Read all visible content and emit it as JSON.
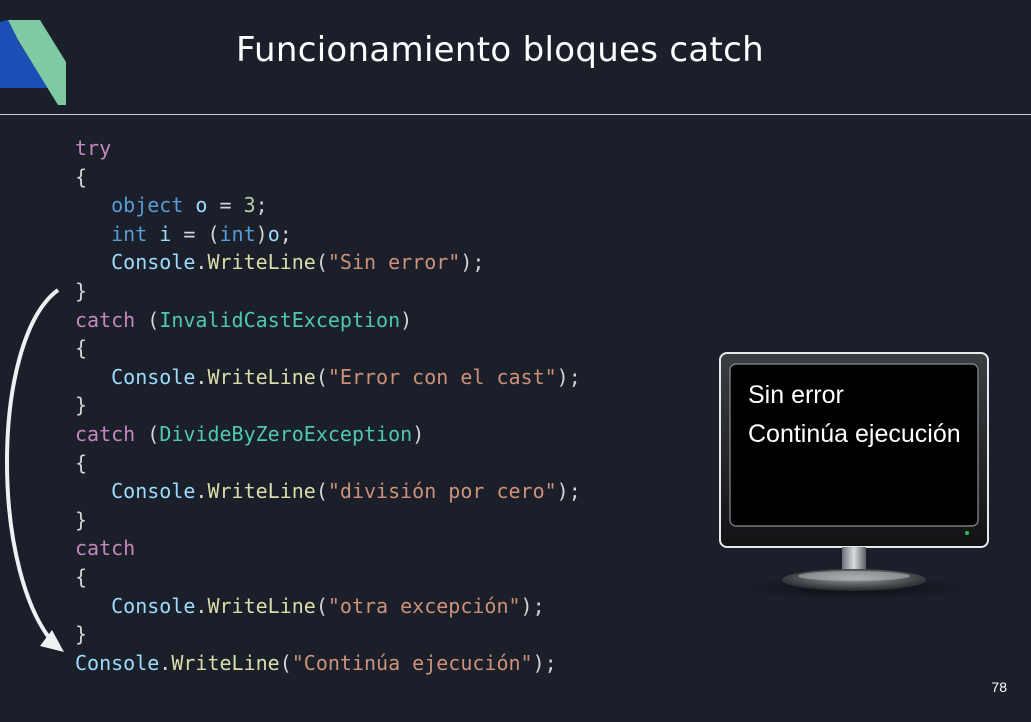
{
  "slide": {
    "title": "Funcionamiento bloques catch",
    "page_number": "78"
  },
  "code": {
    "try_kw": "try",
    "brace_open": "{",
    "brace_close": "}",
    "object_kw": "object",
    "int_kw": "int",
    "var_o": "o",
    "var_i": "i",
    "num_3": "3",
    "console": "Console",
    "writeline": "WriteLine",
    "catch_kw": "catch",
    "exc_invalid_cast": "InvalidCastException",
    "exc_divide_zero": "DivideByZeroException",
    "str_sin_error": "\"Sin error\"",
    "str_error_cast": "\"Error con el cast\"",
    "str_division": "\"división por cero\"",
    "str_otra": "\"otra excepción\"",
    "str_continua": "\"Continúa ejecución\""
  },
  "console_output": {
    "line1": "Sin error",
    "line2": "Continúa ejecución"
  },
  "colors": {
    "background": "#1a1f2a",
    "keyword": "#c586c0",
    "type": "#569cd6",
    "class": "#4ec9b0",
    "method": "#dcdcaa",
    "string": "#ce9178"
  }
}
